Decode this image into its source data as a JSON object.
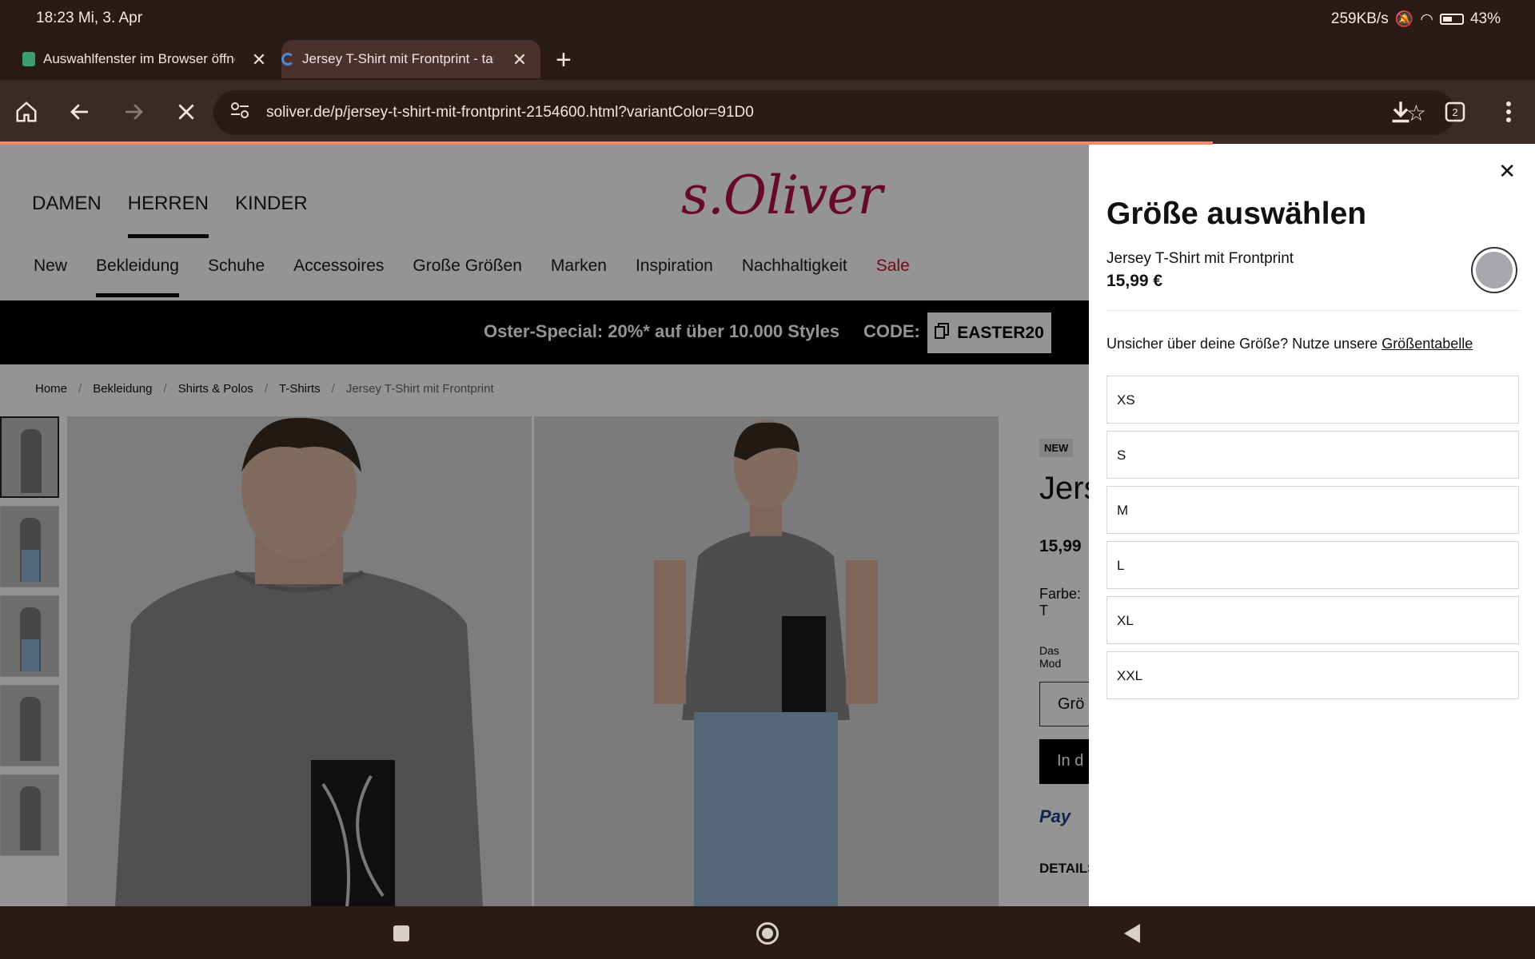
{
  "status_bar": {
    "time": "18:23 Mi, 3. Apr",
    "network_speed": "259KB/s",
    "battery": "43%"
  },
  "tabs": [
    {
      "title": "Auswahlfenster im Browser öffnet",
      "close": "✕"
    },
    {
      "title": "Jersey T-Shirt mit Frontprint - taube",
      "close": "✕"
    }
  ],
  "new_tab": "+",
  "toolbar": {
    "url": "soliver.de/p/jersey-t-shirt-mit-frontprint-2154600.html?variantColor=91D0",
    "tab_count": "2"
  },
  "site": {
    "logo": "s.Oliver",
    "main_nav": [
      "DAMEN",
      "HERREN",
      "KINDER"
    ],
    "sub_nav": [
      "New",
      "Bekleidung",
      "Schuhe",
      "Accessoires",
      "Große Größen",
      "Marken",
      "Inspiration",
      "Nachhaltigkeit",
      "Sale"
    ],
    "promo_text": "Oster-Special: 20%* auf über 10.000 Styles",
    "promo_code_label": "CODE:",
    "promo_code": "EASTER20",
    "breadcrumb": [
      "Home",
      "Bekleidung",
      "Shirts & Polos",
      "T-Shirts",
      "Jersey T-Shirt mit Frontprint"
    ],
    "separator": "/"
  },
  "product": {
    "badge": "NEW",
    "name_visible": "Jers",
    "price_visible": "15,99",
    "color_label": "Farbe: T",
    "model_note": "Das Mod",
    "size_button": "Grö",
    "cart_button": "In d",
    "paypal": "Pay",
    "details": "DETAILS"
  },
  "drawer": {
    "close": "✕",
    "title": "Größe auswählen",
    "product_name": "Jersey T-Shirt mit Frontprint",
    "price": "15,99 €",
    "hint_text": "Unsicher über deine Größe? Nutze unsere ",
    "hint_link": "Größentabelle",
    "swatch_color": "#a7a7ad",
    "sizes": [
      "XS",
      "S",
      "M",
      "L",
      "XL",
      "XXL"
    ]
  },
  "colors": {
    "brand": "#b0124a",
    "sale": "#c4122f",
    "chrome": "#2b1b17",
    "progress": "#f08a6e"
  }
}
